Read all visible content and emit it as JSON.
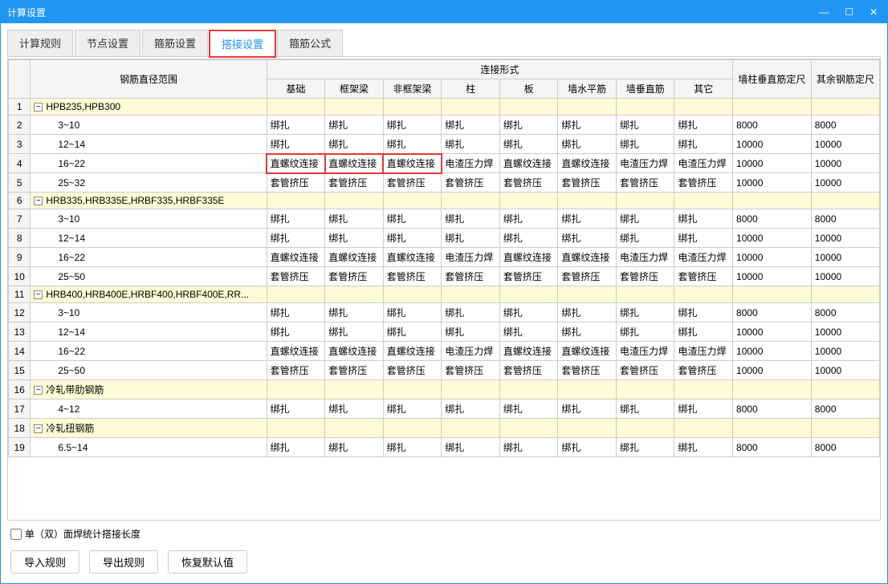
{
  "window": {
    "title": "计算设置"
  },
  "tabs": [
    "计算规则",
    "节点设置",
    "箍筋设置",
    "搭接设置",
    "箍筋公式"
  ],
  "activeTab": 3,
  "highlightTab": 3,
  "highlightCells": [
    {
      "row": 3,
      "cols": [
        0,
        1,
        2
      ]
    }
  ],
  "headers": {
    "range": "钢筋直径范围",
    "connGroup": "连接形式",
    "cols": [
      "基础",
      "框架梁",
      "非框架梁",
      "柱",
      "板",
      "墙水平筋",
      "墙垂直筋",
      "其它"
    ],
    "colA": "墙柱垂直筋定尺",
    "colB": "其余钢筋定尺"
  },
  "rows": [
    {
      "n": 1,
      "group": true,
      "label": "HPB235,HPB300"
    },
    {
      "n": 2,
      "label": "3~10",
      "cells": [
        "绑扎",
        "绑扎",
        "绑扎",
        "绑扎",
        "绑扎",
        "绑扎",
        "绑扎",
        "绑扎"
      ],
      "a": "8000",
      "b": "8000"
    },
    {
      "n": 3,
      "label": "12~14",
      "cells": [
        "绑扎",
        "绑扎",
        "绑扎",
        "绑扎",
        "绑扎",
        "绑扎",
        "绑扎",
        "绑扎"
      ],
      "a": "10000",
      "b": "10000"
    },
    {
      "n": 4,
      "label": "16~22",
      "cells": [
        "直螺纹连接",
        "直螺纹连接",
        "直螺纹连接",
        "电渣压力焊",
        "直螺纹连接",
        "直螺纹连接",
        "电渣压力焊",
        "电渣压力焊"
      ],
      "a": "10000",
      "b": "10000"
    },
    {
      "n": 5,
      "label": "25~32",
      "cells": [
        "套管挤压",
        "套管挤压",
        "套管挤压",
        "套管挤压",
        "套管挤压",
        "套管挤压",
        "套管挤压",
        "套管挤压"
      ],
      "a": "10000",
      "b": "10000"
    },
    {
      "n": 6,
      "group": true,
      "label": "HRB335,HRB335E,HRBF335,HRBF335E"
    },
    {
      "n": 7,
      "label": "3~10",
      "cells": [
        "绑扎",
        "绑扎",
        "绑扎",
        "绑扎",
        "绑扎",
        "绑扎",
        "绑扎",
        "绑扎"
      ],
      "a": "8000",
      "b": "8000"
    },
    {
      "n": 8,
      "label": "12~14",
      "cells": [
        "绑扎",
        "绑扎",
        "绑扎",
        "绑扎",
        "绑扎",
        "绑扎",
        "绑扎",
        "绑扎"
      ],
      "a": "10000",
      "b": "10000"
    },
    {
      "n": 9,
      "label": "16~22",
      "cells": [
        "直螺纹连接",
        "直螺纹连接",
        "直螺纹连接",
        "电渣压力焊",
        "直螺纹连接",
        "直螺纹连接",
        "电渣压力焊",
        "电渣压力焊"
      ],
      "a": "10000",
      "b": "10000"
    },
    {
      "n": 10,
      "label": "25~50",
      "cells": [
        "套管挤压",
        "套管挤压",
        "套管挤压",
        "套管挤压",
        "套管挤压",
        "套管挤压",
        "套管挤压",
        "套管挤压"
      ],
      "a": "10000",
      "b": "10000"
    },
    {
      "n": 11,
      "group": true,
      "label": "HRB400,HRB400E,HRBF400,HRBF400E,RR..."
    },
    {
      "n": 12,
      "label": "3~10",
      "cells": [
        "绑扎",
        "绑扎",
        "绑扎",
        "绑扎",
        "绑扎",
        "绑扎",
        "绑扎",
        "绑扎"
      ],
      "a": "8000",
      "b": "8000"
    },
    {
      "n": 13,
      "label": "12~14",
      "cells": [
        "绑扎",
        "绑扎",
        "绑扎",
        "绑扎",
        "绑扎",
        "绑扎",
        "绑扎",
        "绑扎"
      ],
      "a": "10000",
      "b": "10000"
    },
    {
      "n": 14,
      "label": "16~22",
      "cells": [
        "直螺纹连接",
        "直螺纹连接",
        "直螺纹连接",
        "电渣压力焊",
        "直螺纹连接",
        "直螺纹连接",
        "电渣压力焊",
        "电渣压力焊"
      ],
      "a": "10000",
      "b": "10000"
    },
    {
      "n": 15,
      "label": "25~50",
      "cells": [
        "套管挤压",
        "套管挤压",
        "套管挤压",
        "套管挤压",
        "套管挤压",
        "套管挤压",
        "套管挤压",
        "套管挤压"
      ],
      "a": "10000",
      "b": "10000"
    },
    {
      "n": 16,
      "group": true,
      "label": "冷轧带肋钢筋"
    },
    {
      "n": 17,
      "label": "4~12",
      "cells": [
        "绑扎",
        "绑扎",
        "绑扎",
        "绑扎",
        "绑扎",
        "绑扎",
        "绑扎",
        "绑扎"
      ],
      "a": "8000",
      "b": "8000"
    },
    {
      "n": 18,
      "group": true,
      "label": "冷轧扭钢筋"
    },
    {
      "n": 19,
      "label": "6.5~14",
      "cells": [
        "绑扎",
        "绑扎",
        "绑扎",
        "绑扎",
        "绑扎",
        "绑扎",
        "绑扎",
        "绑扎"
      ],
      "a": "8000",
      "b": "8000"
    }
  ],
  "checkbox": {
    "label": "单（双）面焊统计搭接长度",
    "checked": false
  },
  "buttons": [
    "导入规则",
    "导出规则",
    "恢复默认值"
  ]
}
